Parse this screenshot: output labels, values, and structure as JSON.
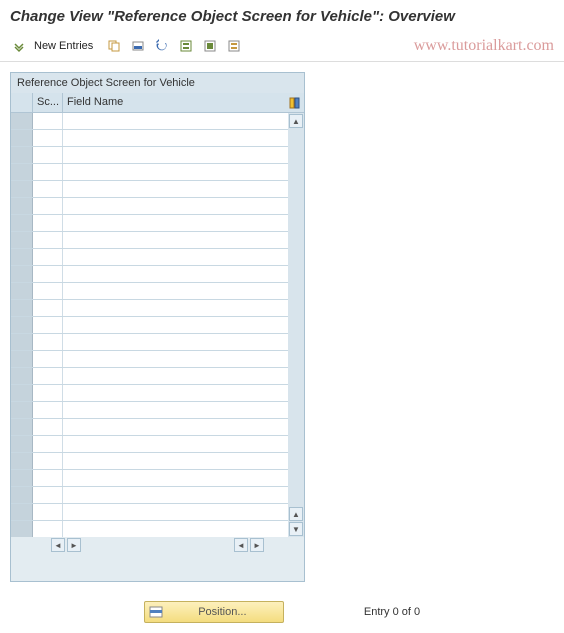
{
  "header": {
    "title": "Change View \"Reference Object Screen for Vehicle\": Overview"
  },
  "toolbar": {
    "new_entries_label": "New Entries"
  },
  "watermark": "www.tutorialkart.com",
  "panel": {
    "title": "Reference Object Screen for Vehicle",
    "columns": {
      "sc": "Sc...",
      "field_name": "Field Name"
    },
    "row_count": 25
  },
  "footer": {
    "position_label": "Position...",
    "entry_status": "Entry 0 of 0"
  }
}
